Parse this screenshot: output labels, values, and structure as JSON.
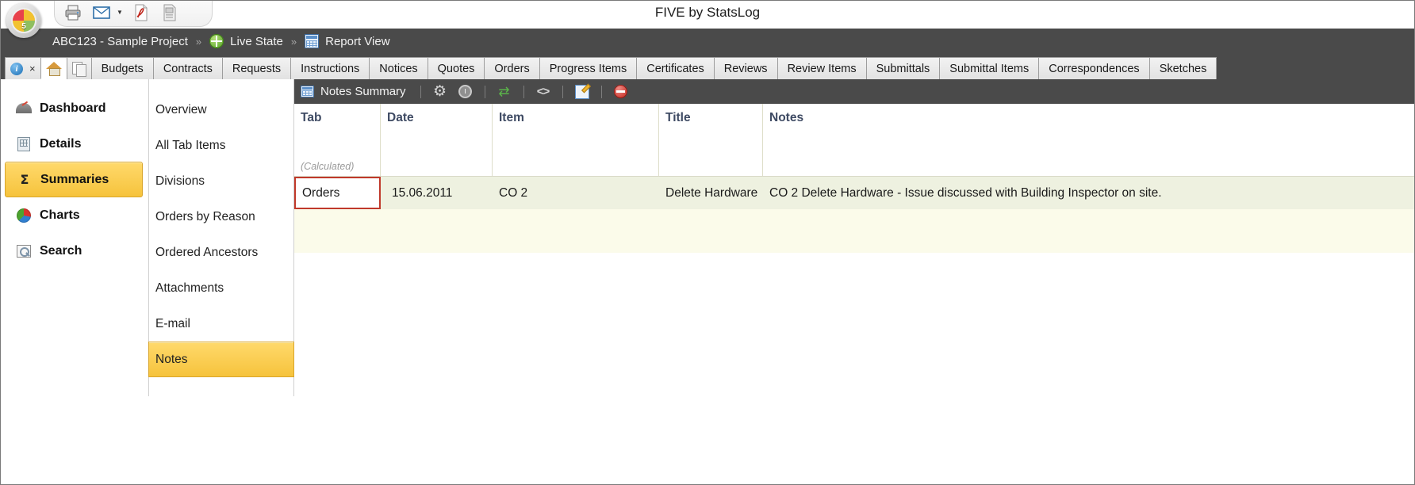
{
  "window": {
    "title": "FIVE by StatsLog",
    "logo_number": "5"
  },
  "quick_access": [
    {
      "name": "print-icon",
      "label": "Print"
    },
    {
      "name": "email-icon",
      "label": "E-mail"
    },
    {
      "name": "pdf-icon",
      "label": "Export to PDF"
    },
    {
      "name": "report-icon",
      "label": "Export Report"
    }
  ],
  "breadcrumb": {
    "project": "ABC123 - Sample Project",
    "sep1": "»",
    "state": "Live State",
    "sep2": "»",
    "view": "Report View"
  },
  "tabs": {
    "system": [
      {
        "name": "info-tab",
        "label": ""
      },
      {
        "name": "close-tab",
        "label": "×"
      },
      {
        "name": "home-tab",
        "label": ""
      },
      {
        "name": "copy-tab",
        "label": ""
      }
    ],
    "items": [
      "Budgets",
      "Contracts",
      "Requests",
      "Instructions",
      "Notices",
      "Quotes",
      "Orders",
      "Progress Items",
      "Certificates",
      "Reviews",
      "Review Items",
      "Submittals",
      "Submittal Items",
      "Correspondences",
      "Sketches"
    ]
  },
  "sidebar": {
    "items": [
      {
        "label": "Dashboard",
        "icon": "dashboard-icon",
        "selected": false
      },
      {
        "label": "Details",
        "icon": "details-icon",
        "selected": false
      },
      {
        "label": "Summaries",
        "icon": "sigma-icon",
        "selected": true
      },
      {
        "label": "Charts",
        "icon": "pie-chart-icon",
        "selected": false
      },
      {
        "label": "Search",
        "icon": "search-icon",
        "selected": false
      }
    ]
  },
  "sublist": {
    "items": [
      {
        "label": "Overview",
        "selected": false
      },
      {
        "label": "All Tab Items",
        "selected": false
      },
      {
        "label": "Divisions",
        "selected": false
      },
      {
        "label": "Orders by Reason",
        "selected": false
      },
      {
        "label": "Ordered Ancestors",
        "selected": false
      },
      {
        "label": "Attachments",
        "selected": false
      },
      {
        "label": "E-mail",
        "selected": false
      },
      {
        "label": "Notes",
        "selected": true
      }
    ]
  },
  "panel": {
    "title": "Notes Summary",
    "toolbar": [
      {
        "name": "settings-gear-icon",
        "label": "Settings"
      },
      {
        "name": "alarm-clock-icon",
        "label": "Schedule"
      },
      {
        "name": "refresh-icon",
        "label": "Refresh"
      },
      {
        "name": "code-brackets-icon",
        "label": "Source"
      },
      {
        "name": "edit-note-icon",
        "label": "Edit"
      },
      {
        "name": "deny-icon",
        "label": "Cancel"
      }
    ]
  },
  "grid": {
    "columns": [
      {
        "key": "tab",
        "label": "Tab",
        "sub": "(Calculated)"
      },
      {
        "key": "date",
        "label": "Date",
        "sub": ""
      },
      {
        "key": "item",
        "label": "Item",
        "sub": ""
      },
      {
        "key": "title",
        "label": "Title",
        "sub": ""
      },
      {
        "key": "notes",
        "label": "Notes",
        "sub": ""
      }
    ],
    "rows": [
      {
        "tab": "Orders",
        "date": "15.06.2011",
        "item": "CO 2",
        "title": "Delete Hardware",
        "notes": "CO 2 Delete Hardware - Issue discussed with Building Inspector on site.",
        "selected_cell": "tab"
      }
    ]
  },
  "colors": {
    "chrome_dark": "#4a4a4a",
    "accent_yellow": "#f6c33c",
    "selection_red": "#c0392b",
    "row_green": "#eef1e0",
    "header_blue": "#3e4a63"
  }
}
